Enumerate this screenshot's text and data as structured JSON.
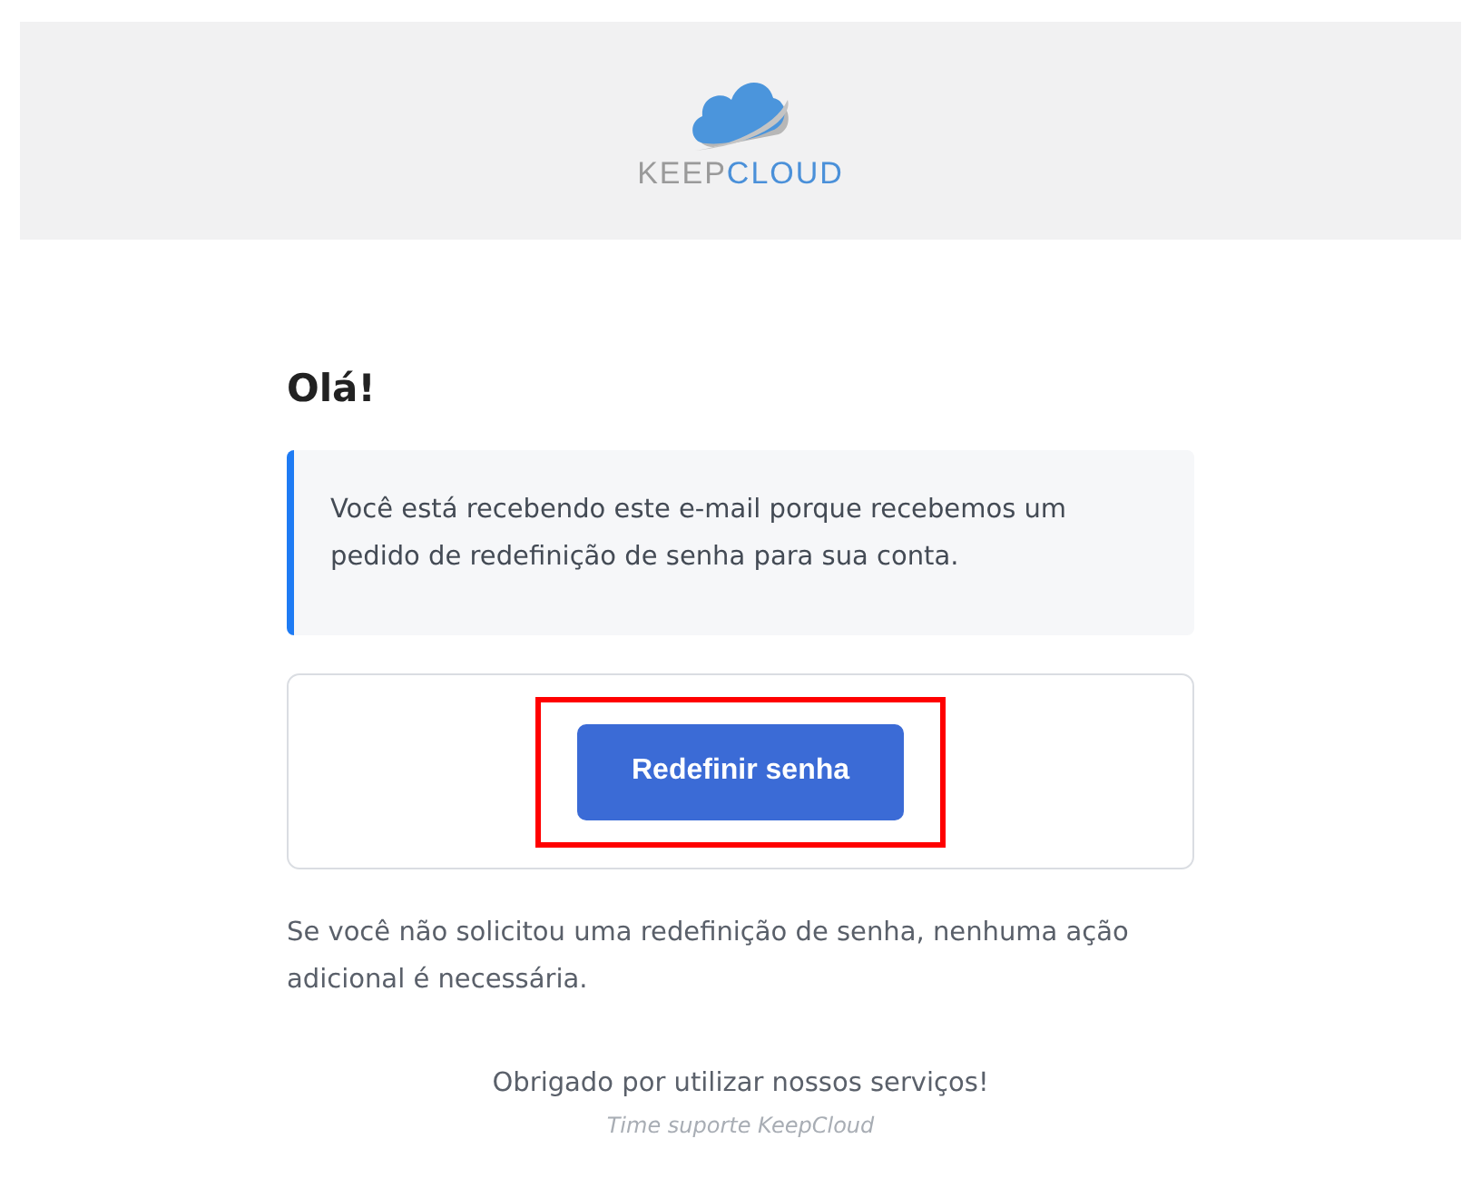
{
  "header": {
    "logo": {
      "part_1": "KEEP",
      "part_2": "CLOUD"
    }
  },
  "greeting": "Olá!",
  "notice": "Você está recebendo este e-mail porque recebemos um pedido de redefinição de senha para sua conta.",
  "action": {
    "label": "Redefinir senha",
    "highlighted": true
  },
  "note": "Se você não solicitou uma redefinição de senha, nenhuma ação adicional é necessária.",
  "thanks": "Obrigado por utilizar nossos serviços!",
  "signature": "Time suporte KeepCloud"
}
